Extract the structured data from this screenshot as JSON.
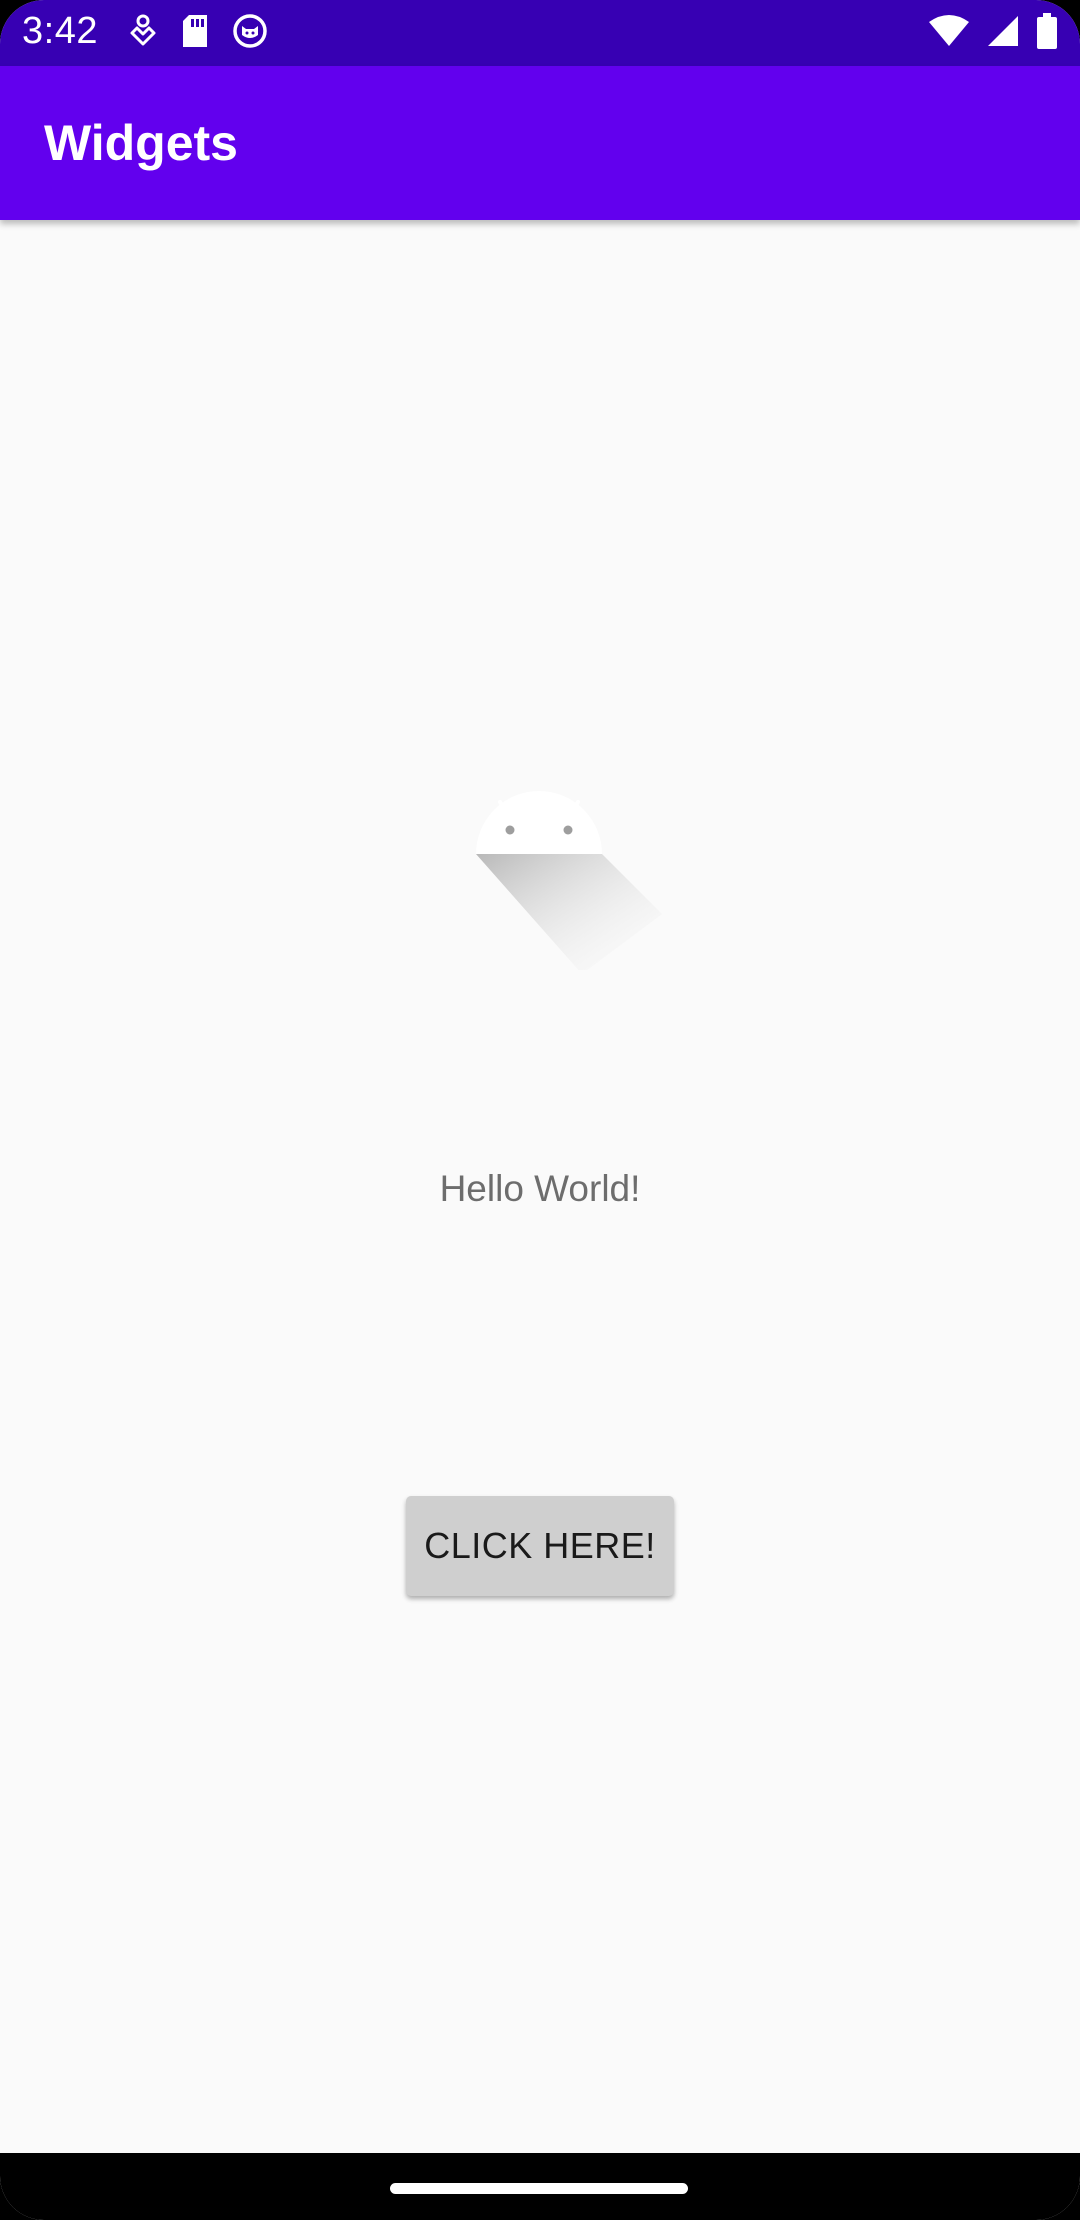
{
  "status_bar": {
    "time": "3:42",
    "icons_left": [
      "handshake-icon",
      "sd-card-icon",
      "cat-icon"
    ],
    "icons_right": [
      "wifi-icon",
      "signal-icon",
      "battery-icon"
    ],
    "color": "#3700b3"
  },
  "app_bar": {
    "title": "Widgets",
    "color": "#6200ee"
  },
  "main": {
    "image_icon": "android-placeholder-icon",
    "text": "Hello World!",
    "button_label": "CLICK HERE!"
  },
  "nav_bar": {
    "handle": "home-gesture-handle"
  }
}
